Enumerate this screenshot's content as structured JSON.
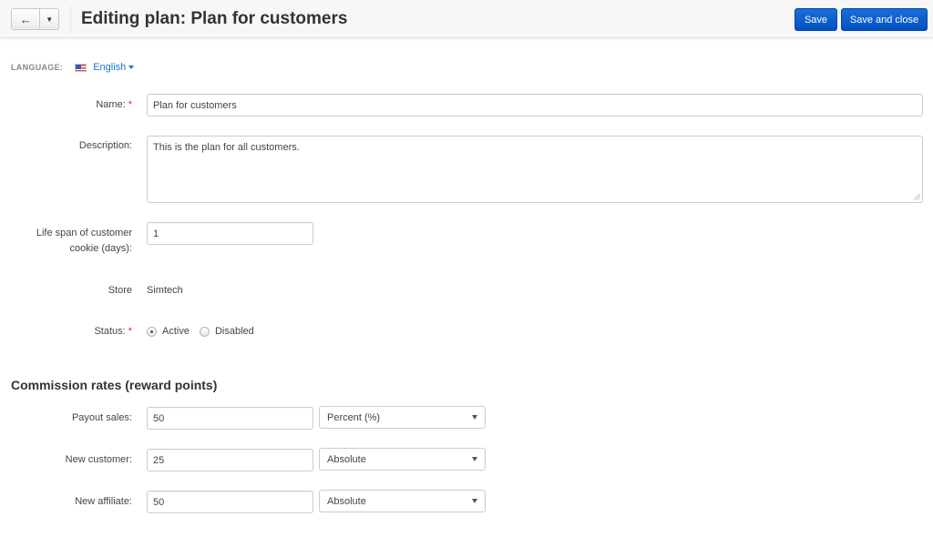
{
  "toolbar": {
    "back_icon": "arrow-left-icon",
    "dropdown_icon": "caret-down-icon",
    "title": "Editing plan: Plan for customers",
    "save_label": "Save",
    "save_close_label": "Save and close",
    "accent_color": "#0050c2"
  },
  "language": {
    "label": "LANGUAGE:",
    "flag_icon": "us-flag-icon",
    "value": "English"
  },
  "form": {
    "name": {
      "label": "Name:",
      "required": "*",
      "value": "Plan for customers"
    },
    "description": {
      "label": "Description:",
      "value": "This is the plan for all customers."
    },
    "cookie": {
      "label_line1": "Life span of customer",
      "label_line2": "cookie (days):",
      "value": "1"
    },
    "store": {
      "label": "Store",
      "value": "Simtech"
    },
    "status": {
      "label": "Status:",
      "required": "*",
      "options": [
        "Active",
        "Disabled"
      ],
      "selected": "Active"
    }
  },
  "commission": {
    "title": "Commission rates (reward points)",
    "rows": [
      {
        "label": "Payout sales:",
        "value": "50",
        "type": "Percent (%)"
      },
      {
        "label": "New customer:",
        "value": "25",
        "type": "Absolute"
      },
      {
        "label": "New affiliate:",
        "value": "50",
        "type": "Absolute"
      }
    ]
  }
}
